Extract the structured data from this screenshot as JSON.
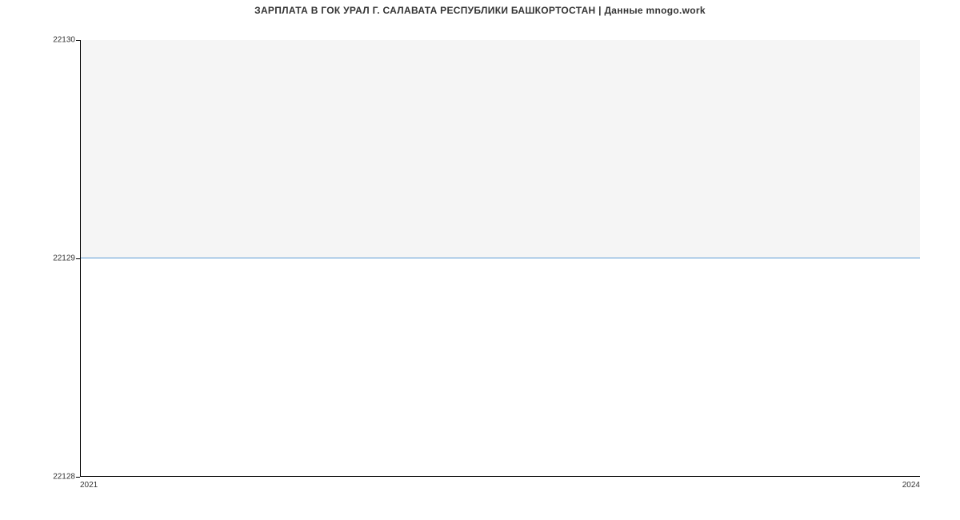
{
  "chart_data": {
    "type": "line",
    "title": "ЗАРПЛАТА В ГОК УРАЛ Г. САЛАВАТА РЕСПУБЛИКИ БАШКОРТОСТАН | Данные mnogo.work",
    "x": [
      2021,
      2024
    ],
    "values": [
      22129,
      22129
    ],
    "xlabel": "",
    "ylabel": "",
    "ylim": [
      22128,
      22130
    ],
    "y_ticks": [
      22128,
      22129,
      22130
    ],
    "x_ticks": [
      2021,
      2024
    ],
    "series_color": "#5b9bd5"
  },
  "labels": {
    "y_top": "22130",
    "y_mid": "22129",
    "y_bot": "22128",
    "x_left": "2021",
    "x_right": "2024"
  }
}
